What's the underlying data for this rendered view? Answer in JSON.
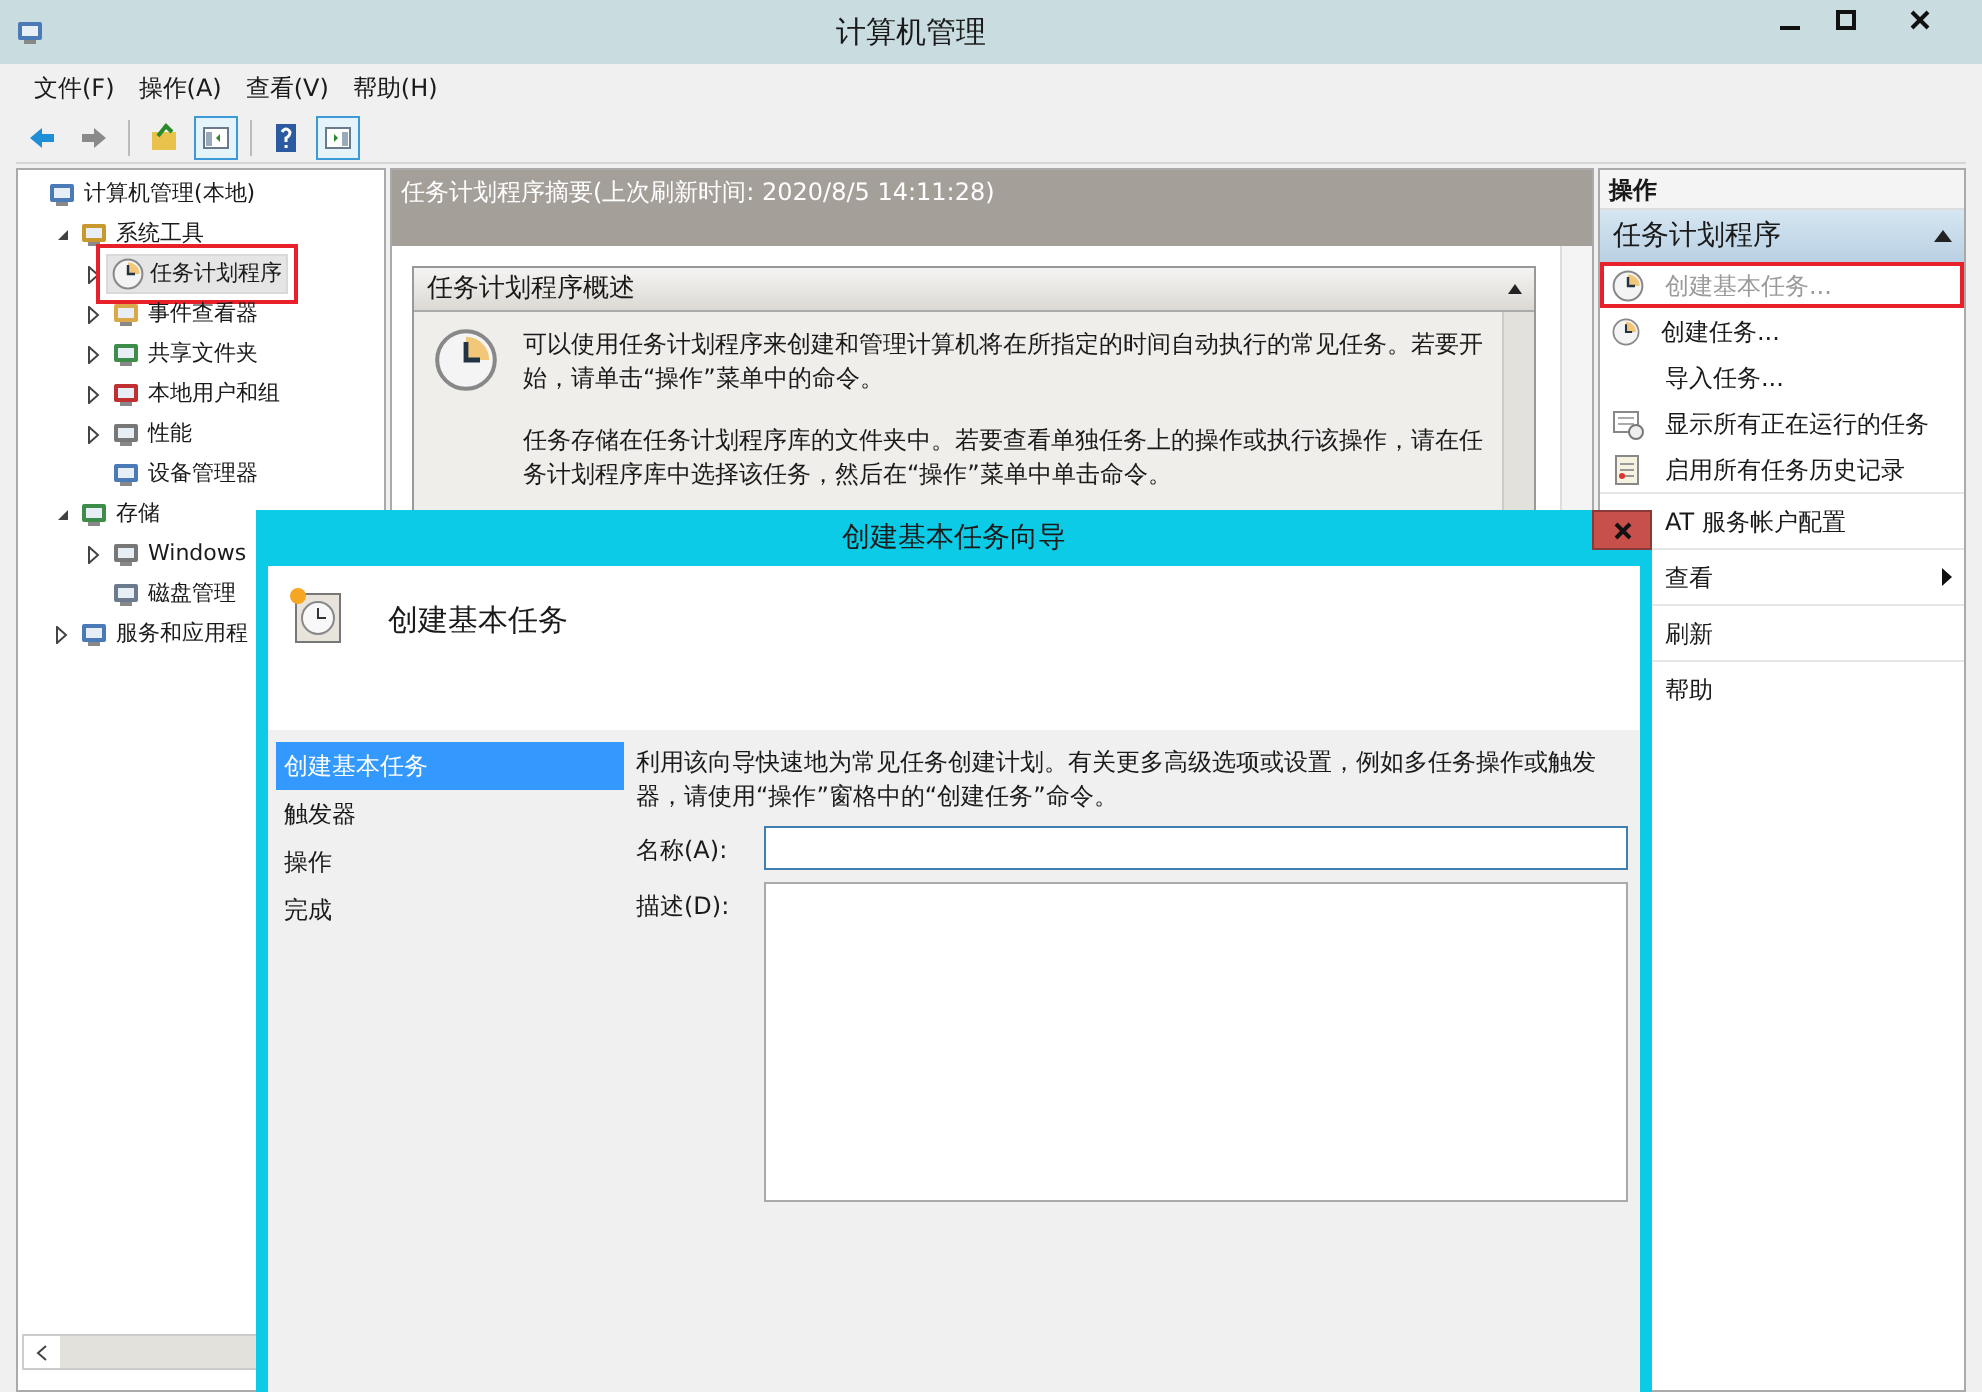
{
  "window": {
    "title": "计算机管理"
  },
  "menu": [
    "文件(F)",
    "操作(A)",
    "查看(V)",
    "帮助(H)"
  ],
  "toolbar": [
    {
      "pressed": false
    },
    {
      "pressed": false
    },
    {
      "pressed": false
    },
    {
      "pressed": true
    },
    {
      "pressed": false
    },
    {
      "pressed": true
    }
  ],
  "tree": [
    {
      "label": "计算机管理(本地)",
      "selected": false,
      "highlighted": false,
      "children": [
        {
          "label": "系统工具",
          "expanded": true,
          "selected": false,
          "highlighted": false,
          "children": [
            {
              "label": "任务计划程序",
              "expanded": false,
              "selected": true,
              "highlighted": true
            },
            {
              "label": "事件查看器",
              "expanded": false,
              "selected": false,
              "highlighted": false
            },
            {
              "label": "共享文件夹",
              "expanded": false,
              "selected": false,
              "highlighted": false
            },
            {
              "label": "本地用户和组",
              "expanded": false,
              "selected": false,
              "highlighted": false
            },
            {
              "label": "性能",
              "expanded": false,
              "selected": false,
              "highlighted": false
            },
            {
              "label": "设备管理器",
              "selected": false,
              "highlighted": false
            }
          ]
        },
        {
          "label": "存储",
          "expanded": true,
          "selected": false,
          "highlighted": false,
          "children": [
            {
              "label": "Windows",
              "expanded": false,
              "selected": false,
              "highlighted": false
            },
            {
              "label": "磁盘管理",
              "selected": false,
              "highlighted": false
            }
          ]
        },
        {
          "label": "服务和应用程",
          "expanded": false,
          "selected": false,
          "highlighted": false
        }
      ]
    }
  ],
  "summary": {
    "header": "任务计划程序摘要(上次刷新时间: 2020/8/5 14:11:28)",
    "section": {
      "title": "任务计划程序概述",
      "expanded": true,
      "paragraphs": [
        "可以使用任务计划程序来创建和管理计算机将在所指定的时间自动执行的常见任务。若要开始，请单击“操作”菜单中的命令。",
        "任务存储在任务计划程序库的文件夹中。若要查看单独任务上的操作或执行该操作，请在任务计划程序库中选择该任务，然后在“操作”菜单中单击命令。"
      ]
    }
  },
  "actions": {
    "header": "操作",
    "section": {
      "title": "任务计划程序",
      "expanded": true
    },
    "groups": [
      [
        {
          "label": "创建基本任务...",
          "disabled": true,
          "highlighted": true,
          "submenu": false
        },
        {
          "label": "创建任务...",
          "disabled": false,
          "highlighted": false,
          "submenu": false
        },
        {
          "label": "导入任务...",
          "disabled": false,
          "highlighted": false,
          "submenu": false
        },
        {
          "label": "显示所有正在运行的任务",
          "disabled": false,
          "highlighted": false,
          "submenu": false
        },
        {
          "label": "启用所有任务历史记录",
          "disabled": false,
          "highlighted": false,
          "submenu": false
        }
      ],
      [
        {
          "label": "AT 服务帐户配置",
          "disabled": false,
          "highlighted": false,
          "submenu": false
        }
      ],
      [
        {
          "label": "查看",
          "disabled": false,
          "highlighted": false,
          "submenu": true
        }
      ],
      [
        {
          "label": "刷新",
          "disabled": false,
          "highlighted": false,
          "submenu": false
        }
      ],
      [
        {
          "label": "帮助",
          "disabled": false,
          "highlighted": false,
          "submenu": false
        }
      ]
    ]
  },
  "dialog": {
    "title": "创建基本任务向导",
    "heading": "创建基本任务",
    "steps": [
      {
        "label": "创建基本任务",
        "selected": true
      },
      {
        "label": "触发器",
        "selected": false
      },
      {
        "label": "操作",
        "selected": false
      },
      {
        "label": "完成",
        "selected": false
      }
    ],
    "intro": "利用该向导快速地为常见任务创建计划。有关更多高级选项或设置，例如多任务操作或触发器，请使用“操作”窗格中的“创建任务”命令。",
    "fields": [
      {
        "label": "名称(A):",
        "kind": "line",
        "focused": true
      },
      {
        "label": "描述(D):",
        "kind": "area",
        "focused": false
      }
    ]
  }
}
